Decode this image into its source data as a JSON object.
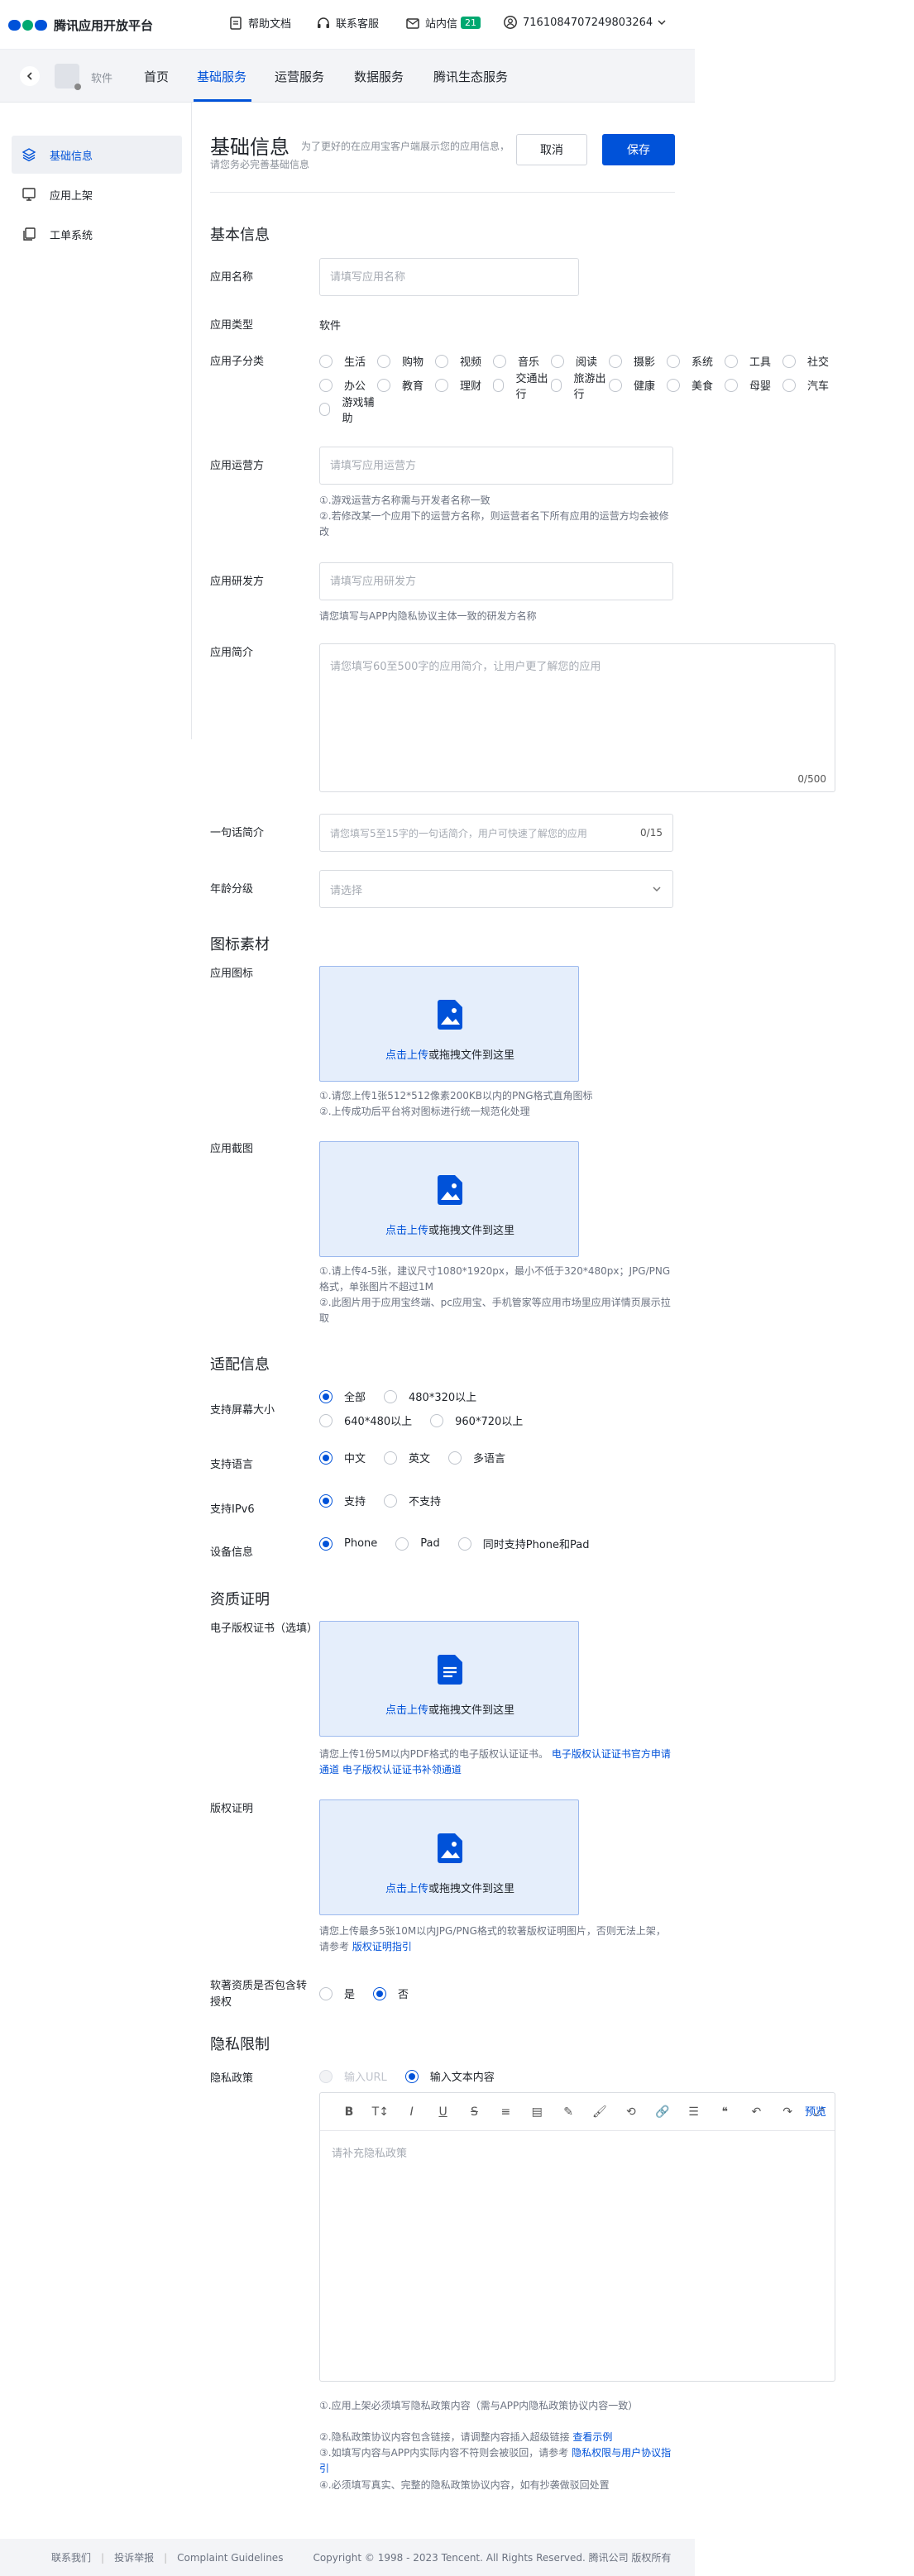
{
  "topbar": {
    "logo": "腾讯应用开放平台",
    "help": "帮助文档",
    "service": "联系客服",
    "messages": "站内信",
    "message_count": "21",
    "account": "7161084707249803264"
  },
  "navbar": {
    "app_name": "软件",
    "tabs": [
      "首页",
      "基础服务",
      "运营服务",
      "数据服务",
      "腾讯生态服务"
    ]
  },
  "sidebar": {
    "items": [
      "基础信息",
      "应用上架",
      "工单系统"
    ]
  },
  "header": {
    "title": "基础信息",
    "hint": "为了更好的在应用宝客户端展示您的应用信息，请您务必完善基础信息",
    "cancel": "取消",
    "save": "保存"
  },
  "basic": {
    "section": "基本信息",
    "app_name_label": "应用名称",
    "app_name_placeholder": "请填写应用名称",
    "type_label": "应用类型",
    "type_value": "软件",
    "subcat_label": "应用子分类",
    "subcats": [
      "生活",
      "购物",
      "视频",
      "音乐",
      "阅读",
      "摄影",
      "系统",
      "工具",
      "社交",
      "办公",
      "教育",
      "理财",
      "交通出行",
      "旅游出行",
      "健康",
      "美食",
      "母婴",
      "汽车",
      "游戏辅助"
    ],
    "operator_label": "应用运营方",
    "operator_placeholder": "请填写应用运营方",
    "operator_hint1": "①.游戏运营方名称需与开发者名称一致",
    "operator_hint2": "②.若修改某一个应用下的运营方名称，则运营者名下所有应用的运营方均会被修改",
    "developer_label": "应用研发方",
    "developer_placeholder": "请填写应用研发方",
    "developer_hint": "请您填写与APP内隐私协议主体一致的研发方名称",
    "intro_label": "应用简介",
    "intro_placeholder": "请您填写60至500字的应用简介，让用户更了解您的应用",
    "intro_count": "0/500",
    "oneline_label": "一句话简介",
    "oneline_placeholder": "请您填写5至15字的一句话简介，用户可快速了解您的应用",
    "oneline_count": "0/15",
    "age_label": "年龄分级",
    "age_placeholder": "请选择"
  },
  "icons": {
    "section": "图标素材",
    "icon_label": "应用图标",
    "upload_link": "点击上传",
    "upload_text": "或拖拽文件到这里",
    "icon_hint1": "①.请您上传1张512*512像素200KB以内的PNG格式直角图标",
    "icon_hint2": "②.上传成功后平台将对图标进行统一规范化处理",
    "shot_label": "应用截图",
    "shot_hint1": "①.请上传4-5张，建议尺寸1080*1920px，最小不低于320*480px；JPG/PNG格式，单张图片不超过1M",
    "shot_hint2": "②.此图片用于应用宝终端、pc应用宝、手机管家等应用市场里应用详情页展示拉取"
  },
  "compat": {
    "section": "适配信息",
    "screen_label": "支持屏幕大小",
    "screens": [
      "全部",
      "480*320以上",
      "640*480以上",
      "960*720以上"
    ],
    "lang_label": "支持语言",
    "langs": [
      "中文",
      "英文",
      "多语言"
    ],
    "ipv6_label": "支持IPv6",
    "ipv6": [
      "支持",
      "不支持"
    ],
    "device_label": "设备信息",
    "devices": [
      "Phone",
      "Pad",
      "同时支持Phone和Pad"
    ]
  },
  "qual": {
    "section": "资质证明",
    "ecert_label": "电子版权证书（选填）",
    "ecert_hint": "请您上传1份5M以内PDF格式的电子版权认证证书。",
    "ecert_link1": "电子版权认证证书官方申请通道",
    "ecert_link2": "电子版权认证证书补领通道",
    "copyright_label": "版权证明",
    "copyright_hint": "请您上传最多5张10M以内JPG/PNG格式的软著版权证明图片，否则无法上架，请参考",
    "copyright_link": "版权证明指引",
    "auth_label": "软著资质是否包含转授权",
    "auth": [
      "是",
      "否"
    ]
  },
  "privacy": {
    "section": "隐私限制",
    "policy_label": "隐私政策",
    "modes": [
      "输入URL",
      "输入文本内容"
    ],
    "preview": "预览",
    "editor_placeholder": "请补充隐私政策",
    "hint1": "①.应用上架必须填写隐私政策内容（需与APP内隐私政策协议内容一致）",
    "hint2": "②.隐私政策协议内容包含链接，请调整内容插入超级链接",
    "hint2_link": "查看示例",
    "hint3": "③.如填写内容与APP内实际内容不符则会被驳回，请参考",
    "hint3_link": "隐私权限与用户协议指引",
    "hint4": "④.必须填写真实、完整的隐私政策协议内容，如有抄袭做驳回处置"
  },
  "footer": {
    "contact": "联系我们",
    "report": "投诉举报",
    "guidelines": "Complaint Guidelines",
    "copyright": "Copyright © 1998 - 2023 Tencent. All Rights Reserved. 腾讯公司 版权所有"
  }
}
